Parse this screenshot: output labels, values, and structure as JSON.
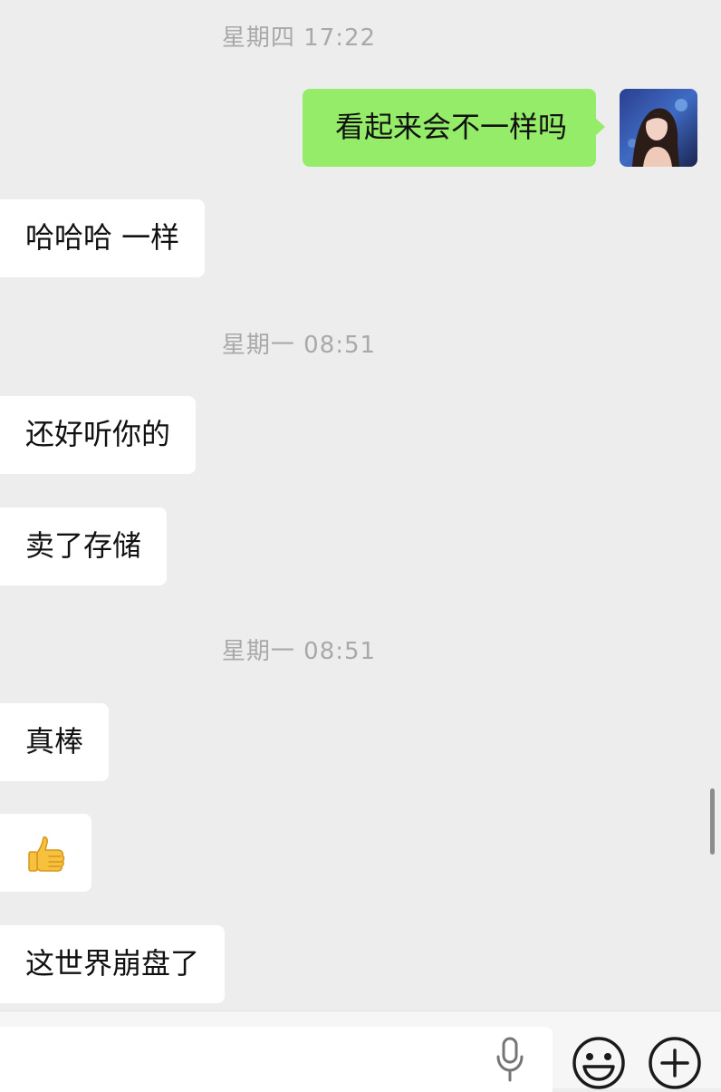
{
  "chat": {
    "timestamps": [
      "星期四 17:22",
      "星期一 08:51",
      "星期一 08:51"
    ],
    "messages": [
      {
        "sender": "me",
        "text": "看起来会不一样吗"
      },
      {
        "sender": "other",
        "text": "哈哈哈 一样"
      },
      {
        "sender": "other",
        "text": "还好听你的"
      },
      {
        "sender": "other",
        "text": "卖了存储"
      },
      {
        "sender": "other",
        "text": "真棒"
      },
      {
        "sender": "other",
        "emoji": "thumbs-up"
      },
      {
        "sender": "other",
        "text": "这世界崩盘了"
      }
    ]
  },
  "input_bar": {
    "text_value": "",
    "icons": [
      "microphone-icon",
      "emoji-icon",
      "plus-icon"
    ]
  },
  "colors": {
    "background": "#ededed",
    "outgoing_bubble": "#95ec69",
    "incoming_bubble": "#ffffff",
    "timestamp_text": "#a9a9a9"
  }
}
